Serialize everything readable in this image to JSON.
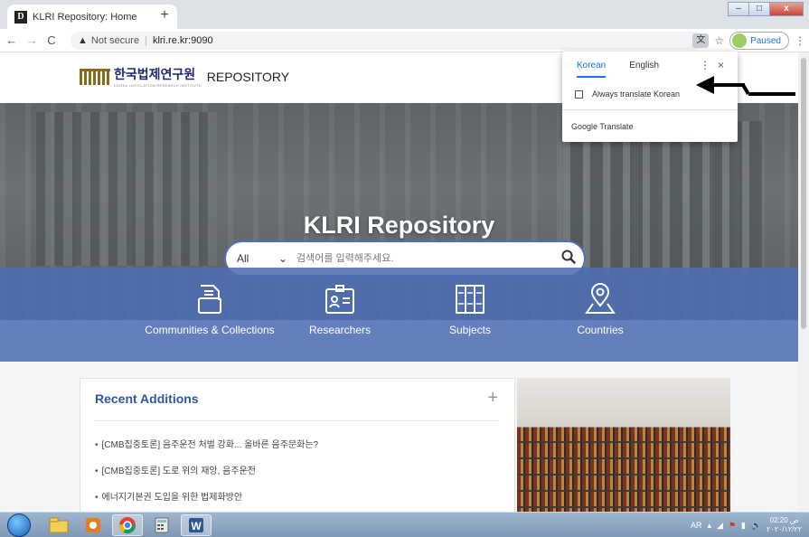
{
  "browser": {
    "tab": {
      "favicon": "D",
      "title": "KLRI Repository: Home",
      "close": "×"
    },
    "new_tab": "+",
    "window": {
      "minimize": "–",
      "maximize": "□",
      "close": "x"
    },
    "address": {
      "warning_icon": "▲",
      "not_secure": "Not secure",
      "separator": "|",
      "url": "klri.re.kr:9090"
    },
    "profile": {
      "label": "Paused"
    },
    "menu": "⋮",
    "bookmark_star": "☆",
    "nav": {
      "back": "←",
      "forward": "→",
      "reload": "C"
    }
  },
  "site": {
    "logo_korean": "한국법제연구원",
    "logo_sub": "KOREA LEGISLATION RESEARCH INSTITUTE",
    "logo_repo": "REPOSITORY",
    "hero_title": "KLRI Repository",
    "search": {
      "scope": "All",
      "placeholder": "검색어를 입력해주세요."
    },
    "categories": [
      {
        "label": "Communities & Collections",
        "icon": "folder-icon"
      },
      {
        "label": "Researchers",
        "icon": "id-card-icon"
      },
      {
        "label": "Subjects",
        "icon": "book-grid-icon"
      },
      {
        "label": "Countries",
        "icon": "map-pin-icon"
      }
    ],
    "recent": {
      "title": "Recent Additions",
      "more": "+",
      "items": [
        "[CMB집중토론] 음주운전 처벌 강화... 올바른 음주문화는?",
        "[CMB집중토론] 도로 위의 재앙, 음주운전",
        "에너지기본권 도입을 위한 법제화방안"
      ]
    }
  },
  "translate_popup": {
    "tabs": [
      "Korean",
      "English"
    ],
    "active_tab": "Korean",
    "menu": "⋮",
    "close": "×",
    "always_translate": "Always translate Korean",
    "footer": "Google Translate"
  },
  "taskbar": {
    "lang": "AR",
    "time": "02:20 ص",
    "date": "٢٠٢٠/١٢/٢٢"
  },
  "colors": {
    "accent": "#2f56a3",
    "band": "#4d6eb4",
    "chrome_blue": "#1a73e8"
  }
}
